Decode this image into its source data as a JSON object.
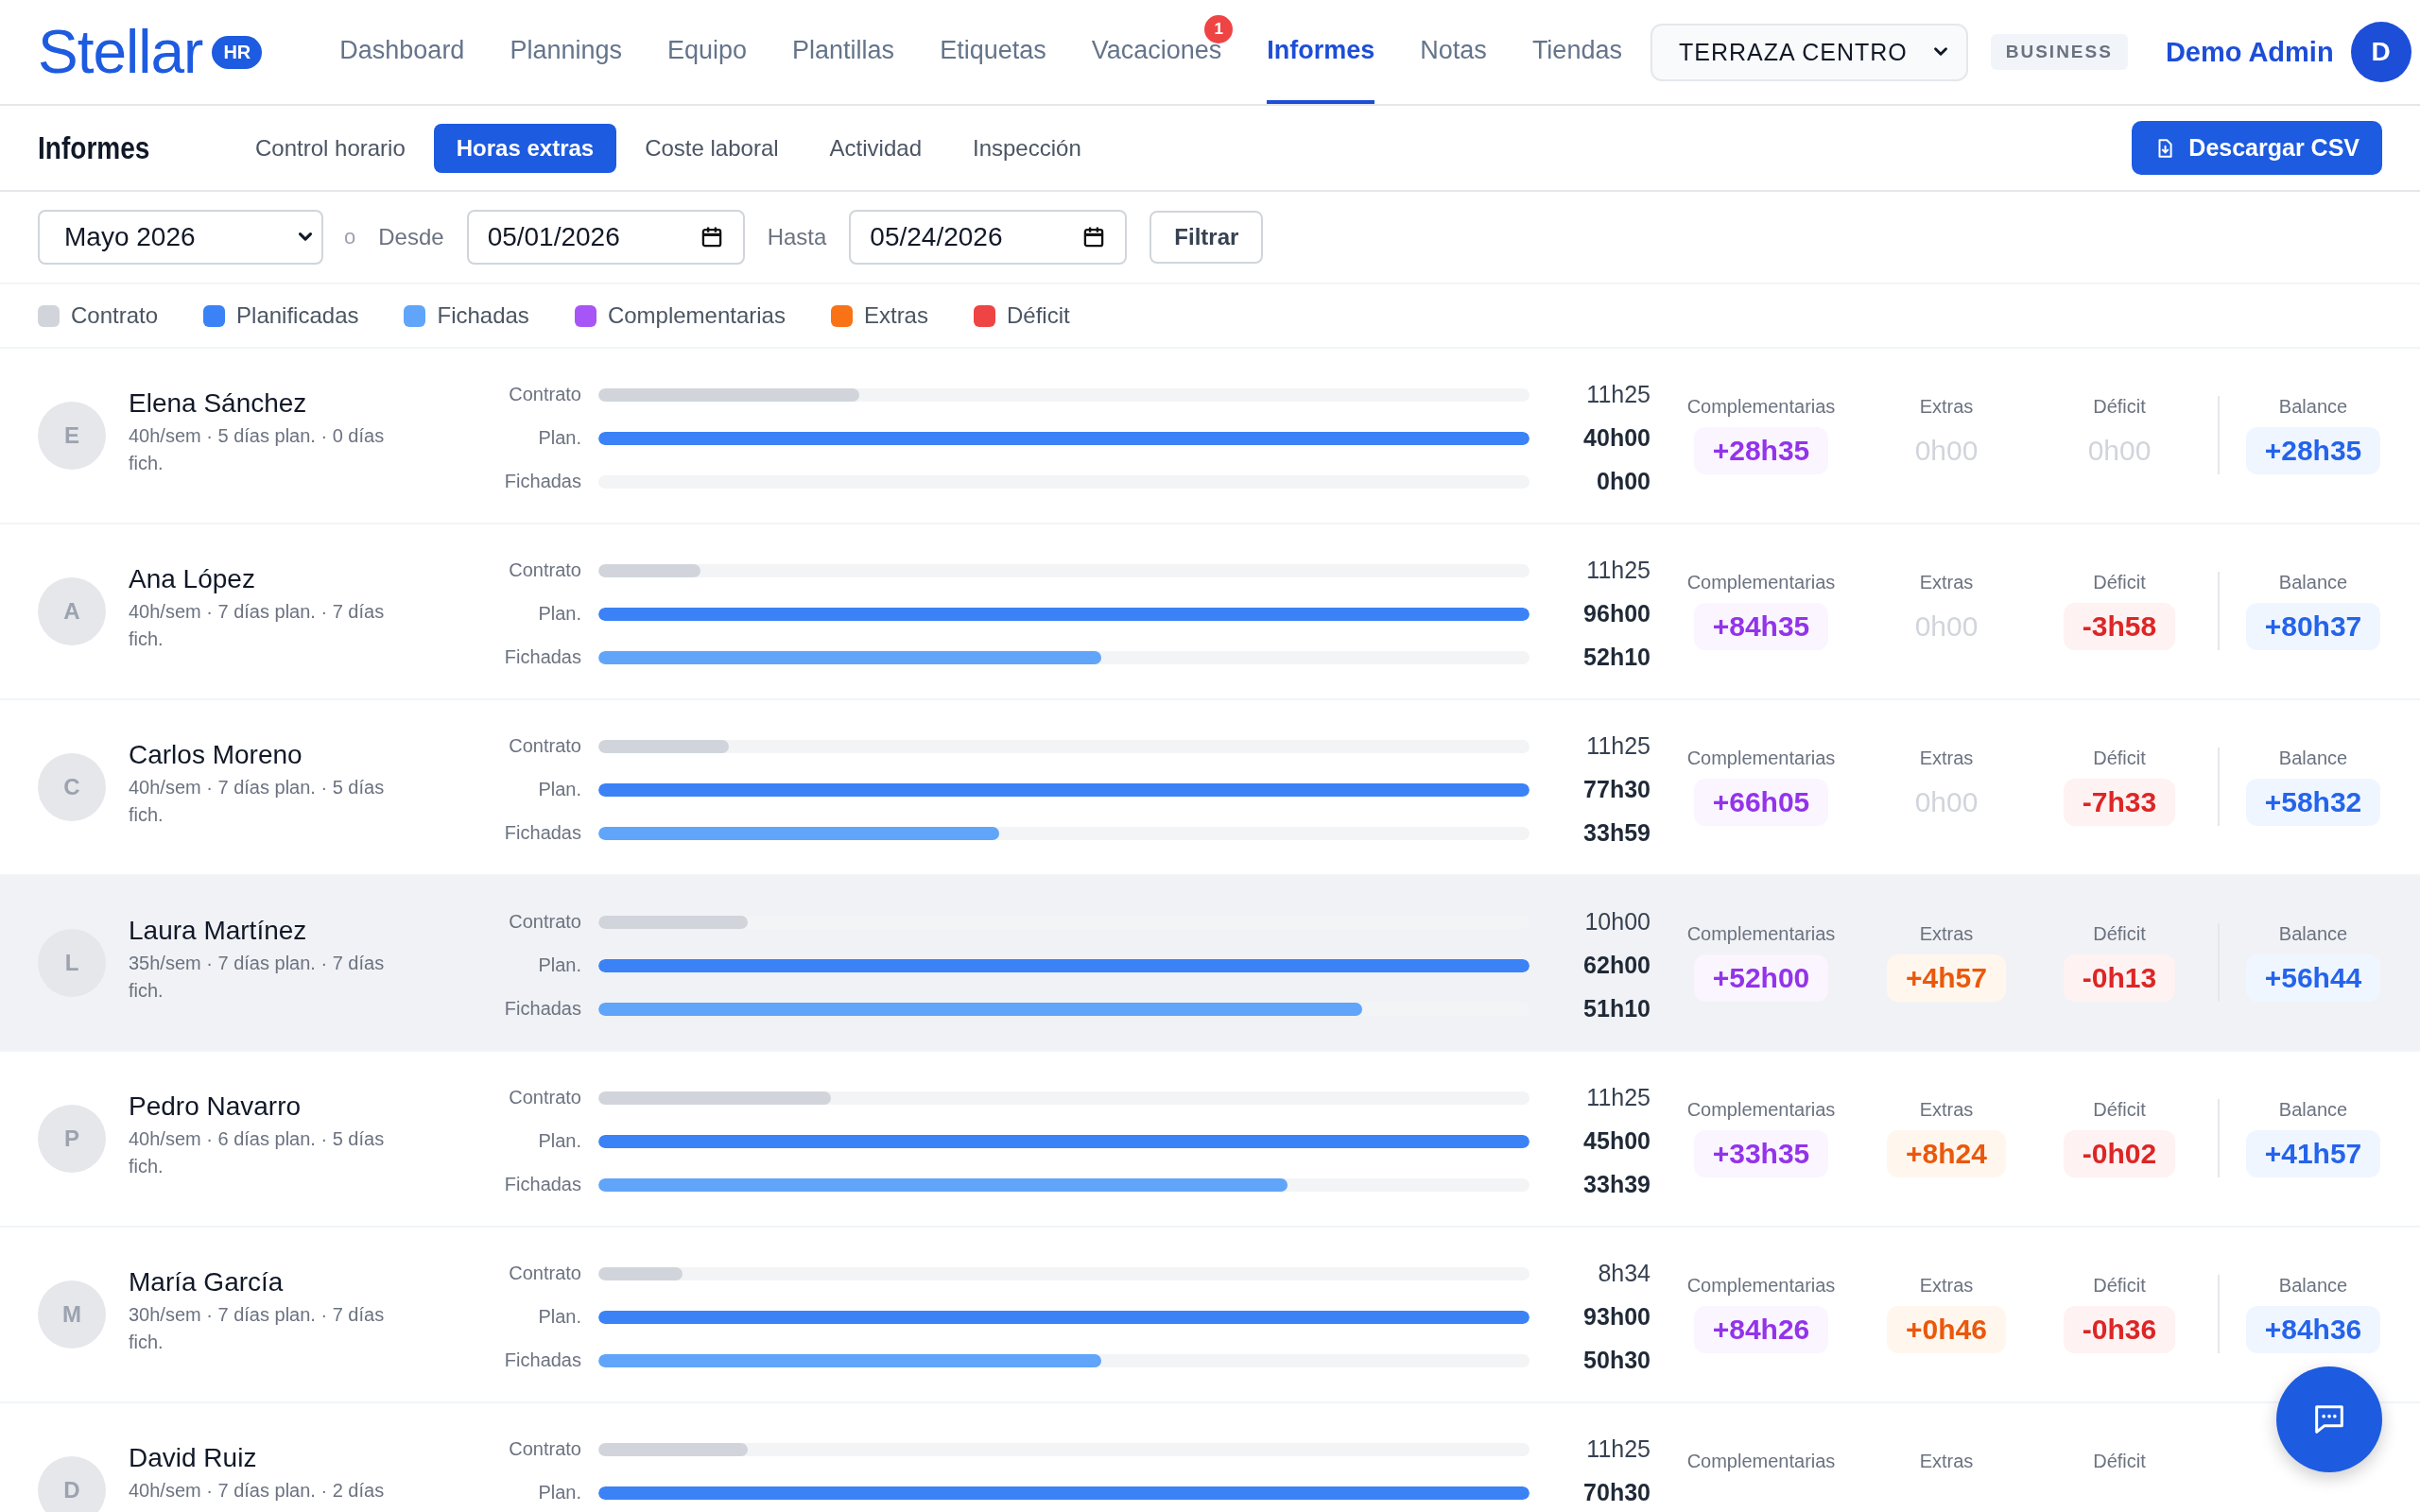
{
  "brand": {
    "name": "Stellar",
    "badge": "HR"
  },
  "nav": [
    {
      "label": "Dashboard",
      "selected": false
    },
    {
      "label": "Plannings",
      "selected": false
    },
    {
      "label": "Equipo",
      "selected": false
    },
    {
      "label": "Plantillas",
      "selected": false
    },
    {
      "label": "Etiquetas",
      "selected": false
    },
    {
      "label": "Vacaciones",
      "selected": false,
      "badge": "1"
    },
    {
      "label": "Informes",
      "selected": true
    },
    {
      "label": "Notas",
      "selected": false
    },
    {
      "label": "Tiendas",
      "selected": false
    }
  ],
  "store_select": {
    "value": "TERRAZA CENTRO"
  },
  "plan_badge": "BUSINESS",
  "user": {
    "name": "Demo Admin",
    "initial": "D"
  },
  "subnav": {
    "title": "Informes",
    "tabs": [
      {
        "label": "Control horario",
        "selected": false
      },
      {
        "label": "Horas extras",
        "selected": true
      },
      {
        "label": "Coste laboral",
        "selected": false
      },
      {
        "label": "Actividad",
        "selected": false
      },
      {
        "label": "Inspección",
        "selected": false
      }
    ],
    "download_button": "Descargar CSV"
  },
  "filters": {
    "month": "Mayo 2026",
    "or": "o",
    "from_label": "Desde",
    "from": "05/01/2026",
    "to_label": "Hasta",
    "to": "05/24/2026",
    "button": "Filtrar"
  },
  "legend": [
    {
      "label": "Contrato",
      "color": "#d1d5db"
    },
    {
      "label": "Planificadas",
      "color": "#3b82f6"
    },
    {
      "label": "Fichadas",
      "color": "#60a5fa"
    },
    {
      "label": "Complementarias",
      "color": "#a855f7"
    },
    {
      "label": "Extras",
      "color": "#f97316"
    },
    {
      "label": "Déficit",
      "color": "#ef4444"
    }
  ],
  "employees": [
    {
      "initial": "E",
      "name": "Elena Sánchez",
      "details": "40h/sem · 5 días plan. · 0 días fich.",
      "highlighted": false,
      "bars": [
        {
          "label": "Contrato",
          "kind": "contract",
          "level": 0.28,
          "value": "11h25"
        },
        {
          "label": "Plan.",
          "kind": "planned",
          "level": 1,
          "value": "40h00"
        },
        {
          "label": "Fichadas",
          "kind": "clocked",
          "level": 0,
          "value": "0h00"
        }
      ],
      "stats": [
        {
          "label": "Complementarias",
          "kind": "complementary",
          "value": "+28h35",
          "zero": false
        },
        {
          "label": "Extras",
          "kind": "extra",
          "value": "0h00",
          "zero": true
        },
        {
          "label": "Déficit",
          "kind": "deficit",
          "value": "0h00",
          "zero": true
        },
        {
          "label": "Balance",
          "kind": "balance",
          "value": "+28h35",
          "zero": false
        }
      ]
    },
    {
      "initial": "A",
      "name": "Ana López",
      "details": "40h/sem · 7 días plan. · 7 días fich.",
      "highlighted": false,
      "bars": [
        {
          "label": "Contrato",
          "kind": "contract",
          "level": 0.11,
          "value": "11h25"
        },
        {
          "label": "Plan.",
          "kind": "planned",
          "level": 1,
          "value": "96h00"
        },
        {
          "label": "Fichadas",
          "kind": "clocked",
          "level": 0.54,
          "value": "52h10"
        }
      ],
      "stats": [
        {
          "label": "Complementarias",
          "kind": "complementary",
          "value": "+84h35",
          "zero": false
        },
        {
          "label": "Extras",
          "kind": "extra",
          "value": "0h00",
          "zero": true
        },
        {
          "label": "Déficit",
          "kind": "deficit",
          "value": "-3h58",
          "zero": false
        },
        {
          "label": "Balance",
          "kind": "balance",
          "value": "+80h37",
          "zero": false
        }
      ]
    },
    {
      "initial": "C",
      "name": "Carlos Moreno",
      "details": "40h/sem · 7 días plan. · 5 días fich.",
      "highlighted": false,
      "bars": [
        {
          "label": "Contrato",
          "kind": "contract",
          "level": 0.14,
          "value": "11h25"
        },
        {
          "label": "Plan.",
          "kind": "planned",
          "level": 1,
          "value": "77h30"
        },
        {
          "label": "Fichadas",
          "kind": "clocked",
          "level": 0.43,
          "value": "33h59"
        }
      ],
      "stats": [
        {
          "label": "Complementarias",
          "kind": "complementary",
          "value": "+66h05",
          "zero": false
        },
        {
          "label": "Extras",
          "kind": "extra",
          "value": "0h00",
          "zero": true
        },
        {
          "label": "Déficit",
          "kind": "deficit",
          "value": "-7h33",
          "zero": false
        },
        {
          "label": "Balance",
          "kind": "balance",
          "value": "+58h32",
          "zero": false
        }
      ]
    },
    {
      "initial": "L",
      "name": "Laura Martínez",
      "details": "35h/sem · 7 días plan. · 7 días fich.",
      "highlighted": true,
      "bars": [
        {
          "label": "Contrato",
          "kind": "contract",
          "level": 0.16,
          "value": "10h00"
        },
        {
          "label": "Plan.",
          "kind": "planned",
          "level": 1,
          "value": "62h00"
        },
        {
          "label": "Fichadas",
          "kind": "clocked",
          "level": 0.82,
          "value": "51h10"
        }
      ],
      "stats": [
        {
          "label": "Complementarias",
          "kind": "complementary",
          "value": "+52h00",
          "zero": false
        },
        {
          "label": "Extras",
          "kind": "extra",
          "value": "+4h57",
          "zero": false
        },
        {
          "label": "Déficit",
          "kind": "deficit",
          "value": "-0h13",
          "zero": false
        },
        {
          "label": "Balance",
          "kind": "balance",
          "value": "+56h44",
          "zero": false
        }
      ]
    },
    {
      "initial": "P",
      "name": "Pedro Navarro",
      "details": "40h/sem · 6 días plan. · 5 días fich.",
      "highlighted": false,
      "bars": [
        {
          "label": "Contrato",
          "kind": "contract",
          "level": 0.25,
          "value": "11h25"
        },
        {
          "label": "Plan.",
          "kind": "planned",
          "level": 1,
          "value": "45h00"
        },
        {
          "label": "Fichadas",
          "kind": "clocked",
          "level": 0.74,
          "value": "33h39"
        }
      ],
      "stats": [
        {
          "label": "Complementarias",
          "kind": "complementary",
          "value": "+33h35",
          "zero": false
        },
        {
          "label": "Extras",
          "kind": "extra",
          "value": "+8h24",
          "zero": false
        },
        {
          "label": "Déficit",
          "kind": "deficit",
          "value": "-0h02",
          "zero": false
        },
        {
          "label": "Balance",
          "kind": "balance",
          "value": "+41h57",
          "zero": false
        }
      ]
    },
    {
      "initial": "M",
      "name": "María García",
      "details": "30h/sem · 7 días plan. · 7 días fich.",
      "highlighted": false,
      "bars": [
        {
          "label": "Contrato",
          "kind": "contract",
          "level": 0.09,
          "value": "8h34"
        },
        {
          "label": "Plan.",
          "kind": "planned",
          "level": 1,
          "value": "93h00"
        },
        {
          "label": "Fichadas",
          "kind": "clocked",
          "level": 0.54,
          "value": "50h30"
        }
      ],
      "stats": [
        {
          "label": "Complementarias",
          "kind": "complementary",
          "value": "+84h26",
          "zero": false
        },
        {
          "label": "Extras",
          "kind": "extra",
          "value": "+0h46",
          "zero": false
        },
        {
          "label": "Déficit",
          "kind": "deficit",
          "value": "-0h36",
          "zero": false
        },
        {
          "label": "Balance",
          "kind": "balance",
          "value": "+84h36",
          "zero": false
        }
      ]
    },
    {
      "initial": "D",
      "name": "David Ruiz",
      "details": "40h/sem · 7 días plan. · 2 días",
      "highlighted": false,
      "bars": [
        {
          "label": "Contrato",
          "kind": "contract",
          "level": 0.16,
          "value": "11h25"
        },
        {
          "label": "Plan.",
          "kind": "planned",
          "level": 1,
          "value": "70h30"
        }
      ],
      "stats": [
        {
          "label": "Complementarias",
          "kind": "complementary"
        },
        {
          "label": "Extras",
          "kind": "extra"
        },
        {
          "label": "Déficit",
          "kind": "deficit"
        }
      ]
    }
  ]
}
